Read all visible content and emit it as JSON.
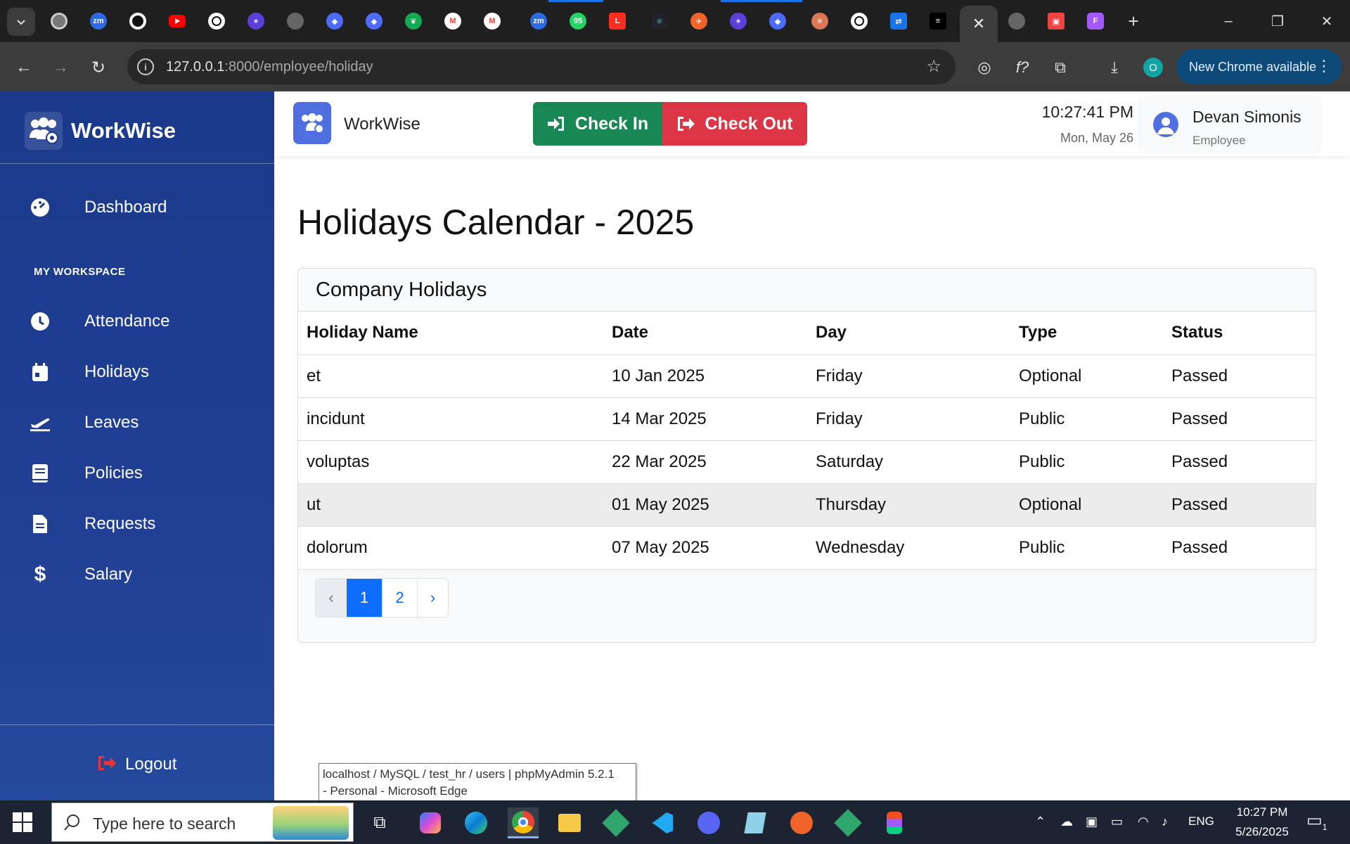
{
  "browser": {
    "url_host": "127.0.0.1",
    "url_path": ":8000/employee/holiday",
    "new_chrome_label": "New Chrome available",
    "profile_initial": "O",
    "tab_badge": "95"
  },
  "sidebar": {
    "brand": "WorkWise",
    "dashboard": "Dashboard",
    "section_heading": "MY WORKSPACE",
    "items": [
      {
        "label": "Attendance",
        "icon": "clock-icon"
      },
      {
        "label": "Holidays",
        "icon": "calendar-icon"
      },
      {
        "label": "Leaves",
        "icon": "plane-icon"
      },
      {
        "label": "Policies",
        "icon": "book-icon"
      },
      {
        "label": "Requests",
        "icon": "file-icon"
      },
      {
        "label": "Salary",
        "icon": "dollar-icon"
      }
    ],
    "logout": "Logout"
  },
  "topbar": {
    "brand": "WorkWise",
    "check_in": "Check In",
    "check_out": "Check Out",
    "time": "10:27:41 PM",
    "date": "Mon, May 26",
    "user_name": "Devan Simonis",
    "user_role": "Employee"
  },
  "main": {
    "title": "Holidays Calendar - 2025",
    "card_title": "Company Holidays",
    "columns": [
      "Holiday Name",
      "Date",
      "Day",
      "Type",
      "Status"
    ],
    "rows": [
      [
        "et",
        "10 Jan 2025",
        "Friday",
        "Optional",
        "Passed"
      ],
      [
        "incidunt",
        "14 Mar 2025",
        "Friday",
        "Public",
        "Passed"
      ],
      [
        "voluptas",
        "22 Mar 2025",
        "Saturday",
        "Public",
        "Passed"
      ],
      [
        "ut",
        "01 May 2025",
        "Thursday",
        "Optional",
        "Passed"
      ],
      [
        "dolorum",
        "07 May 2025",
        "Wednesday",
        "Public",
        "Passed"
      ]
    ],
    "pagination": {
      "prev": "‹",
      "pages": [
        "1",
        "2"
      ],
      "next": "›",
      "current": "1"
    }
  },
  "tooltip": {
    "line1": "localhost / MySQL / test_hr / users | phpMyAdmin 5.2.1",
    "line2": "- Personal - Microsoft Edge"
  },
  "taskbar": {
    "search_placeholder": "Type here to search",
    "lang": "ENG",
    "time": "10:27 PM",
    "date": "5/26/2025",
    "notif_count": "1"
  },
  "colors": {
    "sidebar": "#1b3a8c",
    "check_in": "#198754",
    "check_out": "#dc3545",
    "accent": "#0d6efd"
  }
}
